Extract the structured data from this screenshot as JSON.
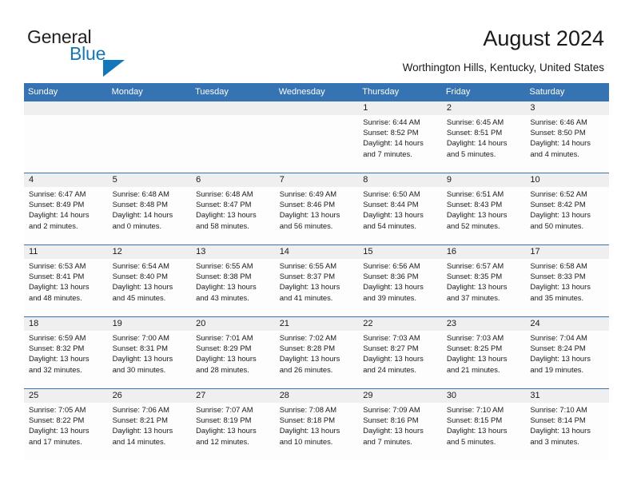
{
  "brand": {
    "name_part1": "General",
    "name_part2": "Blue",
    "accent_color": "#1277bd",
    "triangle_icon": "triangle-icon"
  },
  "header": {
    "title": "August 2024",
    "location": "Worthington Hills, Kentucky, United States"
  },
  "calendar": {
    "header_bg": "#3573b3",
    "daynum_bg": "#efefef",
    "day_names": [
      "Sunday",
      "Monday",
      "Tuesday",
      "Wednesday",
      "Thursday",
      "Friday",
      "Saturday"
    ],
    "weeks": [
      [
        {
          "day": "",
          "sunrise": "",
          "sunset": "",
          "daylight1": "",
          "daylight2": ""
        },
        {
          "day": "",
          "sunrise": "",
          "sunset": "",
          "daylight1": "",
          "daylight2": ""
        },
        {
          "day": "",
          "sunrise": "",
          "sunset": "",
          "daylight1": "",
          "daylight2": ""
        },
        {
          "day": "",
          "sunrise": "",
          "sunset": "",
          "daylight1": "",
          "daylight2": ""
        },
        {
          "day": "1",
          "sunrise": "Sunrise: 6:44 AM",
          "sunset": "Sunset: 8:52 PM",
          "daylight1": "Daylight: 14 hours",
          "daylight2": "and 7 minutes."
        },
        {
          "day": "2",
          "sunrise": "Sunrise: 6:45 AM",
          "sunset": "Sunset: 8:51 PM",
          "daylight1": "Daylight: 14 hours",
          "daylight2": "and 5 minutes."
        },
        {
          "day": "3",
          "sunrise": "Sunrise: 6:46 AM",
          "sunset": "Sunset: 8:50 PM",
          "daylight1": "Daylight: 14 hours",
          "daylight2": "and 4 minutes."
        }
      ],
      [
        {
          "day": "4",
          "sunrise": "Sunrise: 6:47 AM",
          "sunset": "Sunset: 8:49 PM",
          "daylight1": "Daylight: 14 hours",
          "daylight2": "and 2 minutes."
        },
        {
          "day": "5",
          "sunrise": "Sunrise: 6:48 AM",
          "sunset": "Sunset: 8:48 PM",
          "daylight1": "Daylight: 14 hours",
          "daylight2": "and 0 minutes."
        },
        {
          "day": "6",
          "sunrise": "Sunrise: 6:48 AM",
          "sunset": "Sunset: 8:47 PM",
          "daylight1": "Daylight: 13 hours",
          "daylight2": "and 58 minutes."
        },
        {
          "day": "7",
          "sunrise": "Sunrise: 6:49 AM",
          "sunset": "Sunset: 8:46 PM",
          "daylight1": "Daylight: 13 hours",
          "daylight2": "and 56 minutes."
        },
        {
          "day": "8",
          "sunrise": "Sunrise: 6:50 AM",
          "sunset": "Sunset: 8:44 PM",
          "daylight1": "Daylight: 13 hours",
          "daylight2": "and 54 minutes."
        },
        {
          "day": "9",
          "sunrise": "Sunrise: 6:51 AM",
          "sunset": "Sunset: 8:43 PM",
          "daylight1": "Daylight: 13 hours",
          "daylight2": "and 52 minutes."
        },
        {
          "day": "10",
          "sunrise": "Sunrise: 6:52 AM",
          "sunset": "Sunset: 8:42 PM",
          "daylight1": "Daylight: 13 hours",
          "daylight2": "and 50 minutes."
        }
      ],
      [
        {
          "day": "11",
          "sunrise": "Sunrise: 6:53 AM",
          "sunset": "Sunset: 8:41 PM",
          "daylight1": "Daylight: 13 hours",
          "daylight2": "and 48 minutes."
        },
        {
          "day": "12",
          "sunrise": "Sunrise: 6:54 AM",
          "sunset": "Sunset: 8:40 PM",
          "daylight1": "Daylight: 13 hours",
          "daylight2": "and 45 minutes."
        },
        {
          "day": "13",
          "sunrise": "Sunrise: 6:55 AM",
          "sunset": "Sunset: 8:38 PM",
          "daylight1": "Daylight: 13 hours",
          "daylight2": "and 43 minutes."
        },
        {
          "day": "14",
          "sunrise": "Sunrise: 6:55 AM",
          "sunset": "Sunset: 8:37 PM",
          "daylight1": "Daylight: 13 hours",
          "daylight2": "and 41 minutes."
        },
        {
          "day": "15",
          "sunrise": "Sunrise: 6:56 AM",
          "sunset": "Sunset: 8:36 PM",
          "daylight1": "Daylight: 13 hours",
          "daylight2": "and 39 minutes."
        },
        {
          "day": "16",
          "sunrise": "Sunrise: 6:57 AM",
          "sunset": "Sunset: 8:35 PM",
          "daylight1": "Daylight: 13 hours",
          "daylight2": "and 37 minutes."
        },
        {
          "day": "17",
          "sunrise": "Sunrise: 6:58 AM",
          "sunset": "Sunset: 8:33 PM",
          "daylight1": "Daylight: 13 hours",
          "daylight2": "and 35 minutes."
        }
      ],
      [
        {
          "day": "18",
          "sunrise": "Sunrise: 6:59 AM",
          "sunset": "Sunset: 8:32 PM",
          "daylight1": "Daylight: 13 hours",
          "daylight2": "and 32 minutes."
        },
        {
          "day": "19",
          "sunrise": "Sunrise: 7:00 AM",
          "sunset": "Sunset: 8:31 PM",
          "daylight1": "Daylight: 13 hours",
          "daylight2": "and 30 minutes."
        },
        {
          "day": "20",
          "sunrise": "Sunrise: 7:01 AM",
          "sunset": "Sunset: 8:29 PM",
          "daylight1": "Daylight: 13 hours",
          "daylight2": "and 28 minutes."
        },
        {
          "day": "21",
          "sunrise": "Sunrise: 7:02 AM",
          "sunset": "Sunset: 8:28 PM",
          "daylight1": "Daylight: 13 hours",
          "daylight2": "and 26 minutes."
        },
        {
          "day": "22",
          "sunrise": "Sunrise: 7:03 AM",
          "sunset": "Sunset: 8:27 PM",
          "daylight1": "Daylight: 13 hours",
          "daylight2": "and 24 minutes."
        },
        {
          "day": "23",
          "sunrise": "Sunrise: 7:03 AM",
          "sunset": "Sunset: 8:25 PM",
          "daylight1": "Daylight: 13 hours",
          "daylight2": "and 21 minutes."
        },
        {
          "day": "24",
          "sunrise": "Sunrise: 7:04 AM",
          "sunset": "Sunset: 8:24 PM",
          "daylight1": "Daylight: 13 hours",
          "daylight2": "and 19 minutes."
        }
      ],
      [
        {
          "day": "25",
          "sunrise": "Sunrise: 7:05 AM",
          "sunset": "Sunset: 8:22 PM",
          "daylight1": "Daylight: 13 hours",
          "daylight2": "and 17 minutes."
        },
        {
          "day": "26",
          "sunrise": "Sunrise: 7:06 AM",
          "sunset": "Sunset: 8:21 PM",
          "daylight1": "Daylight: 13 hours",
          "daylight2": "and 14 minutes."
        },
        {
          "day": "27",
          "sunrise": "Sunrise: 7:07 AM",
          "sunset": "Sunset: 8:19 PM",
          "daylight1": "Daylight: 13 hours",
          "daylight2": "and 12 minutes."
        },
        {
          "day": "28",
          "sunrise": "Sunrise: 7:08 AM",
          "sunset": "Sunset: 8:18 PM",
          "daylight1": "Daylight: 13 hours",
          "daylight2": "and 10 minutes."
        },
        {
          "day": "29",
          "sunrise": "Sunrise: 7:09 AM",
          "sunset": "Sunset: 8:16 PM",
          "daylight1": "Daylight: 13 hours",
          "daylight2": "and 7 minutes."
        },
        {
          "day": "30",
          "sunrise": "Sunrise: 7:10 AM",
          "sunset": "Sunset: 8:15 PM",
          "daylight1": "Daylight: 13 hours",
          "daylight2": "and 5 minutes."
        },
        {
          "day": "31",
          "sunrise": "Sunrise: 7:10 AM",
          "sunset": "Sunset: 8:14 PM",
          "daylight1": "Daylight: 13 hours",
          "daylight2": "and 3 minutes."
        }
      ]
    ]
  }
}
